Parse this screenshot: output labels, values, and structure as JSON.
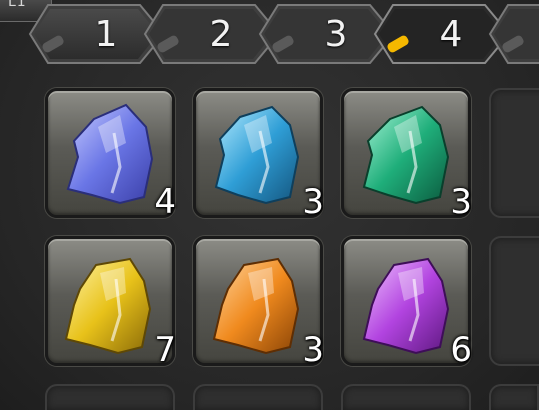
{
  "corner_hint": "L1",
  "tabs": [
    {
      "label": "1",
      "active": false
    },
    {
      "label": "2",
      "active": false
    },
    {
      "label": "3",
      "active": false
    },
    {
      "label": "4",
      "active": true
    }
  ],
  "slots": [
    {
      "item": "blue-crystal-icon",
      "color": "#6a76e6",
      "quantity": "4"
    },
    {
      "item": "cyan-crystal-icon",
      "color": "#2f9ed6",
      "quantity": "3"
    },
    {
      "item": "green-crystal-icon",
      "color": "#1fae7a",
      "quantity": "3"
    },
    {
      "item": "yellow-crystal-icon",
      "color": "#e8c21a",
      "quantity": "7"
    },
    {
      "item": "orange-crystal-icon",
      "color": "#f08a1e",
      "quantity": "3"
    },
    {
      "item": "purple-crystal-icon",
      "color": "#b244e0",
      "quantity": "6"
    }
  ],
  "colors": {
    "tab_active_indicator": "#f5b800",
    "tab_inactive_indicator": "#5a5a5a"
  }
}
